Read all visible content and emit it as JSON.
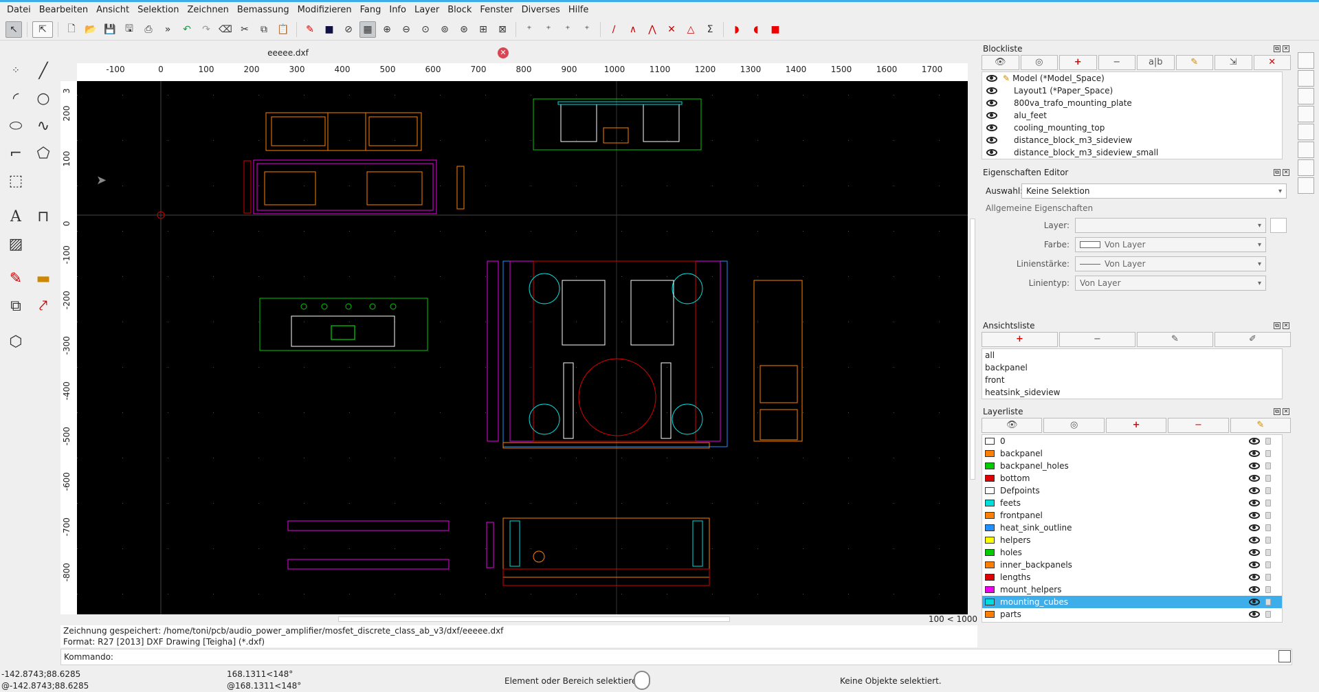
{
  "menu": [
    "Datei",
    "Bearbeiten",
    "Ansicht",
    "Selektion",
    "Zeichnen",
    "Bemassung",
    "Modifizieren",
    "Fang",
    "Info",
    "Layer",
    "Block",
    "Fenster",
    "Diverses",
    "Hilfe"
  ],
  "document": {
    "tab_title": "eeeee.dxf"
  },
  "ruler": {
    "h_labels": [
      "-100",
      "0",
      "100",
      "200",
      "300",
      "400",
      "500",
      "600",
      "700",
      "800",
      "900",
      "1000",
      "1100",
      "1200",
      "1300",
      "1400",
      "1500",
      "1600",
      "1700"
    ],
    "v_labels": [
      "3",
      "200",
      "100",
      "0",
      "-100",
      "-200",
      "-300",
      "-400",
      "-500",
      "-600",
      "-700",
      "-800"
    ]
  },
  "zoom_label": "100 < 1000",
  "history": {
    "line1": "Zeichnung gespeichert: /home/toni/pcb/audio_power_amplifier/mosfet_discrete_class_ab_v3/dxf/eeeee.dxf",
    "line2": "Format: R27 [2013] DXF Drawing [Teigha] (*.dxf)"
  },
  "command": {
    "label": "Kommando:"
  },
  "status": {
    "coord_abs": "-142.8743;88.6285",
    "coord_rel": "@-142.8743;88.6285",
    "polar_abs": "168.1311<148°",
    "polar_rel": "@168.1311<148°",
    "hint": "Element oder Bereich selektieren",
    "selection": "Keine Objekte selektiert."
  },
  "blocklist": {
    "title": "Blockliste",
    "items": [
      "Model (*Model_Space)",
      "Layout1 (*Paper_Space)",
      "800va_trafo_mounting_plate",
      "alu_feet",
      "cooling_mounting_top",
      "distance_block_m3_sideview",
      "distance_block_m3_sideview_small"
    ]
  },
  "properties": {
    "title": "Eigenschaften Editor",
    "select_label": "Auswahl:",
    "select_value": "Keine Selektion",
    "group": "Allgemeine Eigenschaften",
    "layer_label": "Layer:",
    "color_label": "Farbe:",
    "color_value": "Von Layer",
    "linewidth_label": "Linienstärke:",
    "linewidth_value": "Von Layer",
    "linetype_label": "Linientyp:",
    "linetype_value": "Von Layer"
  },
  "viewlist": {
    "title": "Ansichtsliste",
    "items": [
      "all",
      "backpanel",
      "front",
      "heatsink_sideview"
    ]
  },
  "layerlist": {
    "title": "Layerliste",
    "layers": [
      {
        "name": "0",
        "color": "#ffffff"
      },
      {
        "name": "backpanel",
        "color": "#ff7f00"
      },
      {
        "name": "backpanel_holes",
        "color": "#00cc00"
      },
      {
        "name": "bottom",
        "color": "#dd0000"
      },
      {
        "name": "Defpoints",
        "color": "#ffffff"
      },
      {
        "name": "feets",
        "color": "#00dddd"
      },
      {
        "name": "frontpanel",
        "color": "#ff7f00"
      },
      {
        "name": "heat_sink_outline",
        "color": "#1e90ff"
      },
      {
        "name": "helpers",
        "color": "#ffff00"
      },
      {
        "name": "holes",
        "color": "#00cc00"
      },
      {
        "name": "inner_backpanels",
        "color": "#ff7f00"
      },
      {
        "name": "lengths",
        "color": "#dd0000"
      },
      {
        "name": "mount_helpers",
        "color": "#ee00ee"
      },
      {
        "name": "mounting_cubes",
        "color": "#00dddd"
      },
      {
        "name": "parts",
        "color": "#ff7f00"
      }
    ],
    "highlighted": "mounting_cubes"
  },
  "colors": {
    "accent": "#3daee9",
    "canvas": "#000000"
  }
}
